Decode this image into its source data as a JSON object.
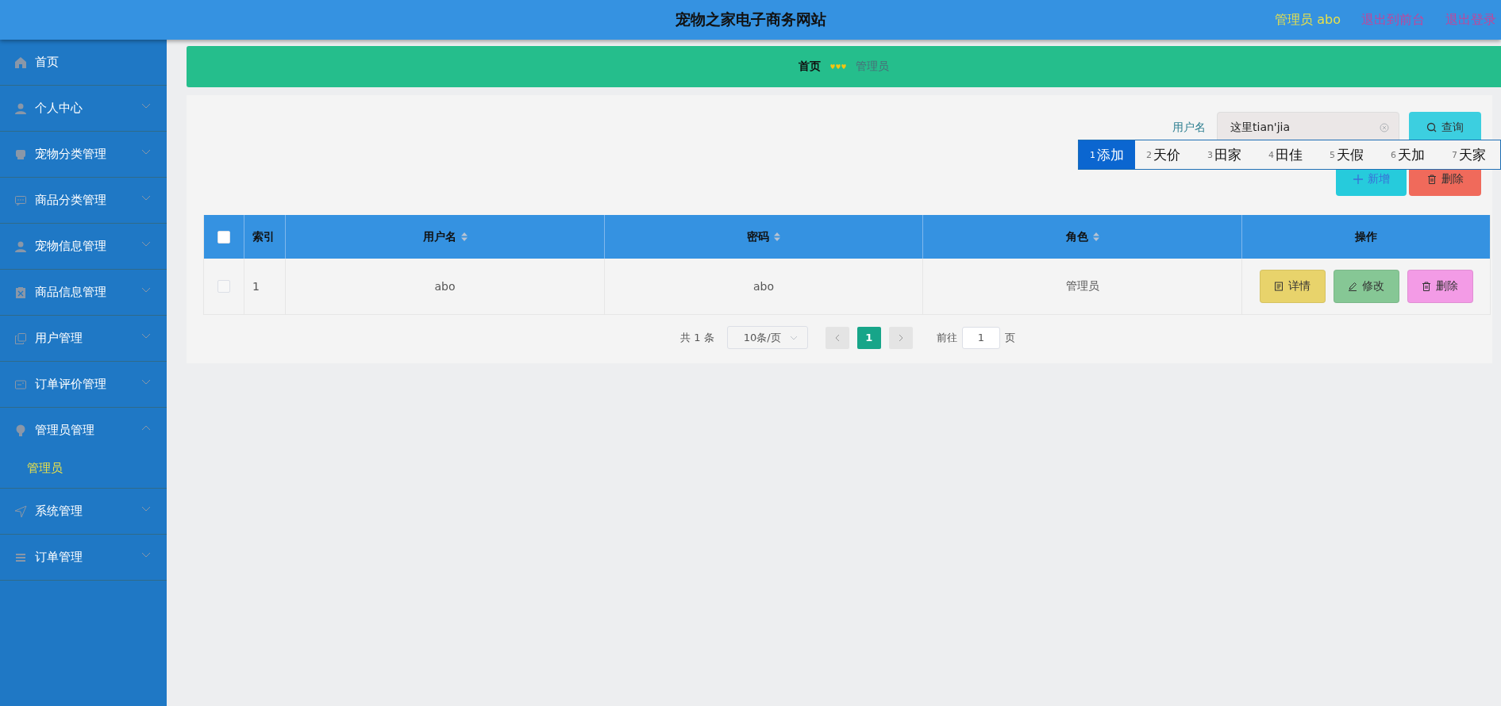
{
  "header": {
    "title": "宠物之家电子商务网站",
    "user": "管理员 abo",
    "links": [
      "退出到前台",
      "退出登录"
    ]
  },
  "sidebar": {
    "items": [
      {
        "label": "首页",
        "kind": "link"
      },
      {
        "label": "个人中心",
        "kind": "menu",
        "expanded": false
      },
      {
        "label": "宠物分类管理",
        "kind": "menu",
        "expanded": false
      },
      {
        "label": "商品分类管理",
        "kind": "menu",
        "expanded": false
      },
      {
        "label": "宠物信息管理",
        "kind": "menu",
        "expanded": false
      },
      {
        "label": "商品信息管理",
        "kind": "menu",
        "expanded": false
      },
      {
        "label": "用户管理",
        "kind": "menu",
        "expanded": false
      },
      {
        "label": "订单评价管理",
        "kind": "menu",
        "expanded": false
      },
      {
        "label": "管理员管理",
        "kind": "menu",
        "expanded": true,
        "children": [
          {
            "label": "管理员",
            "selected": true
          }
        ]
      },
      {
        "label": "系统管理",
        "kind": "menu",
        "expanded": false
      },
      {
        "label": "订单管理",
        "kind": "menu",
        "expanded": false
      }
    ]
  },
  "breadcrumb": [
    "首页",
    "管理员"
  ],
  "search": {
    "label": "用户名",
    "value": "这里tian'jia",
    "button": "查询"
  },
  "ime_candidates": [
    {
      "index": "1",
      "text": "添加",
      "selected": true
    },
    {
      "index": "2",
      "text": "天价",
      "selected": false
    },
    {
      "index": "3",
      "text": "田家",
      "selected": false
    },
    {
      "index": "4",
      "text": "田佳",
      "selected": false
    },
    {
      "index": "5",
      "text": "天假",
      "selected": false
    },
    {
      "index": "6",
      "text": "天加",
      "selected": false
    },
    {
      "index": "7",
      "text": "天家",
      "selected": false
    }
  ],
  "actions": [
    {
      "label": "新增",
      "kind": "add"
    },
    {
      "label": "删除",
      "kind": "delete"
    }
  ],
  "table": {
    "all_checked": false,
    "columns": [
      {
        "label": "索引",
        "sortable": false
      },
      {
        "label": "用户名",
        "sortable": true
      },
      {
        "label": "密码",
        "sortable": true
      },
      {
        "label": "角色",
        "sortable": true
      },
      {
        "label": "操作",
        "sortable": false
      }
    ],
    "rows": [
      {
        "checked": false,
        "cells": [
          "1",
          "abo",
          "abo",
          "管理员"
        ],
        "actions": [
          {
            "label": "详情",
            "kind": "detail"
          },
          {
            "label": "修改",
            "kind": "edit"
          },
          {
            "label": "删除",
            "kind": "delete"
          }
        ]
      }
    ]
  },
  "pagination": {
    "total": "共 1 条",
    "page_size": "10条/页",
    "pages": [
      {
        "label": "1",
        "selected": true
      }
    ],
    "goto_label": "前往",
    "goto_value": "1",
    "goto_suffix": "页"
  }
}
